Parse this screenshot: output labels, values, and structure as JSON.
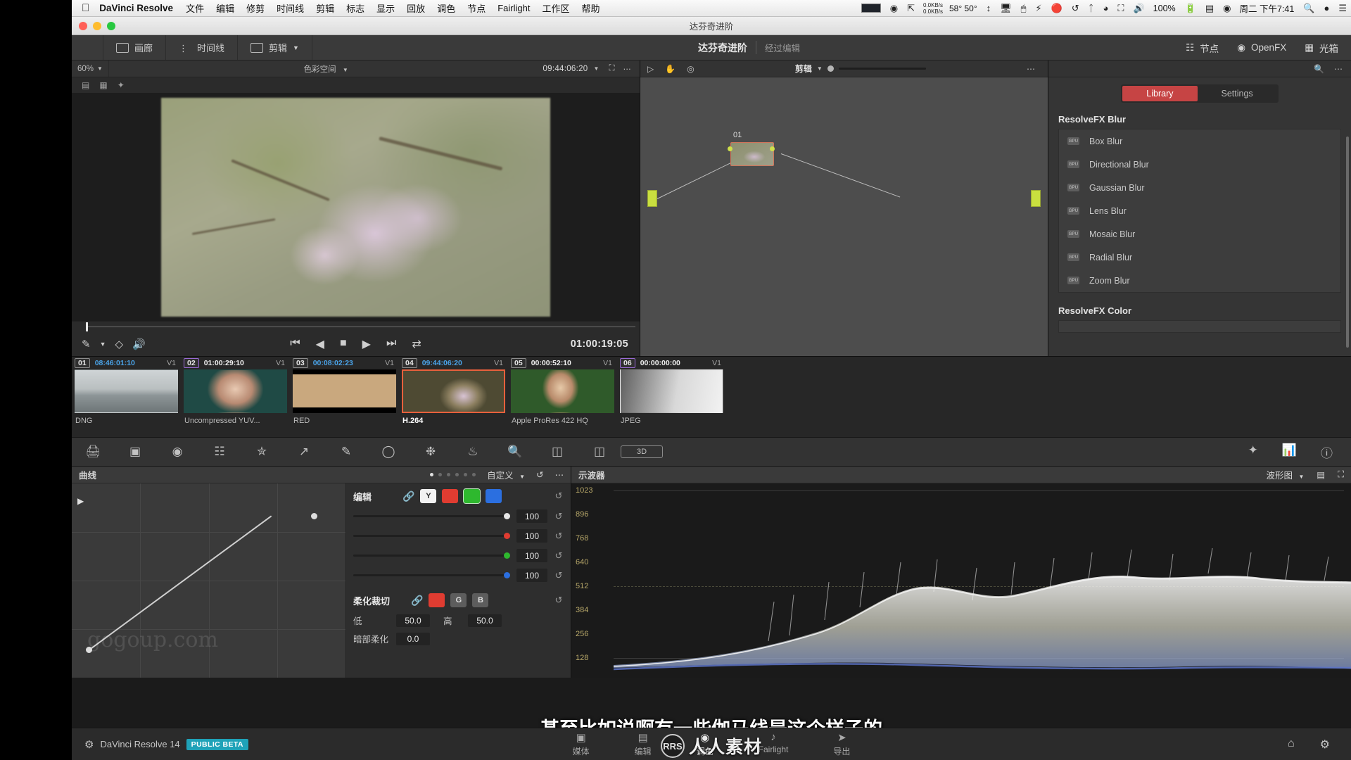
{
  "menubar": {
    "apple_icon": "apple-icon",
    "app_name": "DaVinci Resolve",
    "menus": [
      "文件",
      "编辑",
      "修剪",
      "时间线",
      "剪辑",
      "标志",
      "显示",
      "回放",
      "调色",
      "节点",
      "Fairlight",
      "工作区",
      "帮助"
    ],
    "net_up": "0.0KB/s",
    "net_down": "0.0KB/s",
    "temps": "58° 50°",
    "battery_pct": "100%",
    "clock": "周二 下午7:41",
    "status_icons": [
      "screenshot-swatch-icon",
      "globe-icon",
      "expand-icon",
      "network-speed-icon",
      "temperature-icon",
      "updown-arrows-icon",
      "display-icon",
      "mouse-icon",
      "lightning-icon",
      "record-icon",
      "clock-history-icon",
      "bluetooth-icon",
      "wifi-icon",
      "airplay-icon",
      "volume-icon",
      "battery-icon",
      "control-center-icon",
      "siri-icon",
      "spotlight-icon",
      "user-icon",
      "list-icon"
    ]
  },
  "window": {
    "title": "达芬奇进阶"
  },
  "toolbar": {
    "gallery_label": "画廊",
    "timeline_label": "时间线",
    "clips_label": "剪辑",
    "project_title": "达芬奇进阶",
    "project_status": "经过编辑",
    "nodes_label": "节点",
    "openfx_label": "OpenFX",
    "lightbox_label": "光箱"
  },
  "viewer": {
    "zoom_level": "60%",
    "colorspace_label": "色彩空间",
    "timecode": "09:44:06:20",
    "current_timecode": "01:00:19:05",
    "transport_icons": [
      "skip-back-icon",
      "step-back-icon",
      "stop-icon",
      "play-icon",
      "skip-forward-icon",
      "loop-icon"
    ],
    "tool_icons": [
      "eyedropper-icon",
      "chevron-down-icon",
      "layers-icon",
      "speaker-icon"
    ]
  },
  "nodegraph": {
    "mode_label": "剪辑",
    "node_label": "01",
    "toolbar_icons": [
      "pointer-icon",
      "hand-icon",
      "target-icon",
      "more-icon"
    ]
  },
  "fxpanel": {
    "tabs": [
      {
        "label": "Library",
        "active": true
      },
      {
        "label": "Settings",
        "active": false
      }
    ],
    "sections": [
      {
        "title": "ResolveFX Blur",
        "items": [
          "Box Blur",
          "Directional Blur",
          "Gaussian Blur",
          "Lens Blur",
          "Mosaic Blur",
          "Radial Blur",
          "Zoom Blur"
        ]
      },
      {
        "title": "ResolveFX Color",
        "items": []
      }
    ],
    "gpu_badge": "GPU",
    "search_icon": "search-icon",
    "more_icon": "more-icon"
  },
  "clips": [
    {
      "num": "01",
      "tc": "08:46:01:10",
      "track": "V1",
      "name": "DNG",
      "tc_color": "#4aa3e8",
      "selected": false,
      "active": false
    },
    {
      "num": "02",
      "tc": "01:00:29:10",
      "track": "V1",
      "name": "Uncompressed YUV...",
      "tc_color": "#f0f0f0",
      "selected": true,
      "active": false
    },
    {
      "num": "03",
      "tc": "00:08:02:23",
      "track": "V1",
      "name": "RED",
      "tc_color": "#4aa3e8",
      "selected": false,
      "active": false
    },
    {
      "num": "04",
      "tc": "09:44:06:20",
      "track": "V1",
      "name": "H.264",
      "tc_color": "#4aa3e8",
      "selected": false,
      "active": true
    },
    {
      "num": "05",
      "tc": "00:00:52:10",
      "track": "V1",
      "name": "Apple ProRes 422 HQ",
      "tc_color": "#f0f0f0",
      "selected": false,
      "active": false
    },
    {
      "num": "06",
      "tc": "00:00:00:00",
      "track": "V1",
      "name": "JPEG",
      "tc_color": "#f0f0f0",
      "selected": true,
      "active": false
    }
  ],
  "palette_icons": [
    "print-icon",
    "clip-icon",
    "color-wheel-icon",
    "primaries-bars-icon",
    "log-wheel-icon",
    "curves-icon",
    "qualifier-icon",
    "power-window-icon",
    "tracker-icon",
    "blur-icon",
    "key-icon",
    "sizing-icon",
    "data-burn-icon",
    "three-d-icon"
  ],
  "palette_right_icons": [
    "keyframe-icon",
    "scopes-icon",
    "info-icon"
  ],
  "curves": {
    "title": "曲线",
    "preset": "自定义",
    "reset_icon": "reset-icon",
    "more_icon": "more-icon",
    "watermark": "gogoup.com",
    "edit": {
      "title": "编辑",
      "link_icon": "link-icon",
      "channels": [
        {
          "key": "Y",
          "color": "#f2f2f2",
          "active": false
        },
        {
          "key": "R",
          "color": "#e03c31",
          "active": false
        },
        {
          "key": "G",
          "color": "#2eb82e",
          "active": true
        },
        {
          "key": "B",
          "color": "#2b6fe0",
          "active": false
        }
      ],
      "sliders": [
        {
          "color": "#e8e8e8",
          "value": "100"
        },
        {
          "color": "#e03c31",
          "value": "100"
        },
        {
          "color": "#2eb82e",
          "value": "100"
        },
        {
          "color": "#2b6fe0",
          "value": "100"
        }
      ]
    },
    "softclip": {
      "title": "柔化裁切",
      "link_icon": "link-icon",
      "channels": [
        {
          "key": "R",
          "color": "#e03c31"
        },
        {
          "key": "G",
          "color": "#5d5d5d"
        },
        {
          "key": "B",
          "color": "#5d5d5d"
        }
      ],
      "rows": [
        {
          "label_a": "低",
          "value_a": "50.0",
          "label_b": "高",
          "value_b": "50.0"
        },
        {
          "label_a": "暗部柔化",
          "value_a": "0.0",
          "label_b": "",
          "value_b": ""
        }
      ]
    }
  },
  "scopes": {
    "title": "示波器",
    "mode": "波形图",
    "axis_labels": [
      "1023",
      "896",
      "768",
      "640",
      "512",
      "384",
      "256",
      "128"
    ],
    "icons": [
      "chevron-down-icon",
      "settings-icon",
      "expand-icon"
    ]
  },
  "subtitle": "甚至比如说啊有一些伽马线是这个样子的",
  "statusbar": {
    "app_name": "DaVinci Resolve 14",
    "beta_badge": "PUBLIC BETA",
    "pages": [
      {
        "label": "媒体",
        "icon": "media-icon",
        "active": false
      },
      {
        "label": "编辑",
        "icon": "edit-icon",
        "active": false
      },
      {
        "label": "调色",
        "icon": "color-icon",
        "active": true
      },
      {
        "label": "Fairlight",
        "icon": "audio-icon",
        "active": false
      },
      {
        "label": "导出",
        "icon": "deliver-icon",
        "active": false
      }
    ],
    "right_icons": [
      "home-icon",
      "gear-icon"
    ],
    "watermark_text": "人人素材",
    "watermark_logo": "RRS"
  },
  "colors": {
    "accent_red": "#e8603c",
    "tab_active": "#c64444",
    "node_port": "#c9df3f",
    "beta_badge": "#1fa2b8",
    "timecode_blue": "#4aa3e8"
  }
}
